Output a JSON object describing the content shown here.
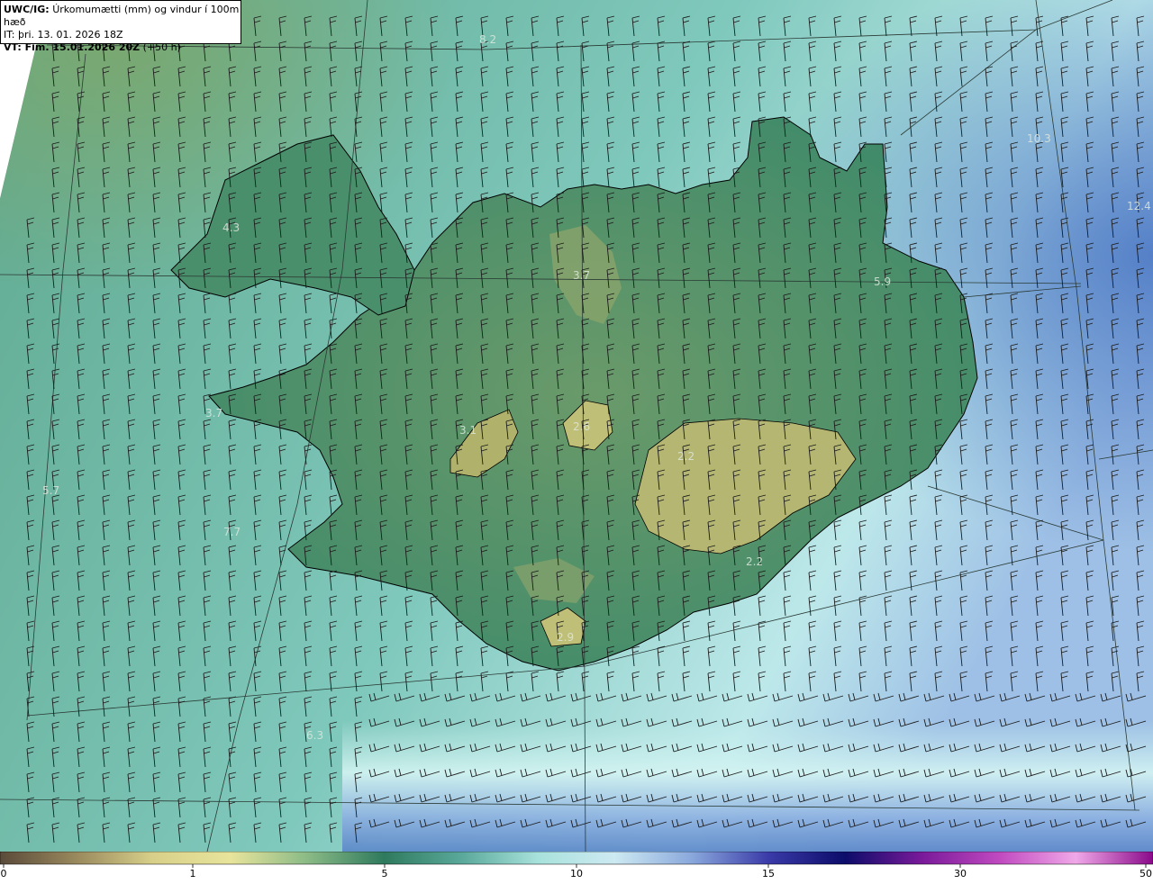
{
  "header": {
    "model": "UWC/IG:",
    "title": "Úrkomumætti (mm) og vindur í 100m hæð",
    "init_time": "IT: þri. 13. 01. 2026 18Z",
    "valid_prefix": "VT: Fim. 15.01.2026 20Z",
    "valid_suffix": "(+50 h)"
  },
  "colorbar": {
    "ticks": [
      {
        "label": "0",
        "value": 0
      },
      {
        "label": "1",
        "value": 1
      },
      {
        "label": "5",
        "value": 5
      },
      {
        "label": "10",
        "value": 10
      },
      {
        "label": "15",
        "value": 15
      },
      {
        "label": "30",
        "value": 30
      },
      {
        "label": "50",
        "value": 50
      }
    ],
    "colors": [
      "#5a4a3a",
      "#9a8a5e",
      "#d8d08a",
      "#e8e49c",
      "#8aba86",
      "#2f7a5e",
      "#5aa89a",
      "#a8e2dc",
      "#cde9f2",
      "#8aa8dc",
      "#3a3aa8",
      "#0c0c6a",
      "#7a1a9a",
      "#c04ac0",
      "#f0a8e8",
      "#8a0a8a"
    ]
  },
  "map_labels": [
    {
      "text": "4.3"
    },
    {
      "text": "3.7"
    },
    {
      "text": "5.9"
    },
    {
      "text": "12.4"
    },
    {
      "text": "3.7"
    },
    {
      "text": "3.1"
    },
    {
      "text": "2.6"
    },
    {
      "text": "2.2"
    },
    {
      "text": "5.7"
    },
    {
      "text": "7.7"
    },
    {
      "text": "2.2"
    },
    {
      "text": "2.9"
    },
    {
      "text": "6.3"
    },
    {
      "text": "8.2"
    },
    {
      "text": "10.3"
    }
  ],
  "colors": {
    "ocean_mid": "#6fbcb2",
    "ocean_light": "#bfeaea",
    "ocean_deep": "#5a86c8",
    "land_low": "#3e8a6a",
    "land_high": "#b8ba72",
    "coast": "#000000"
  }
}
